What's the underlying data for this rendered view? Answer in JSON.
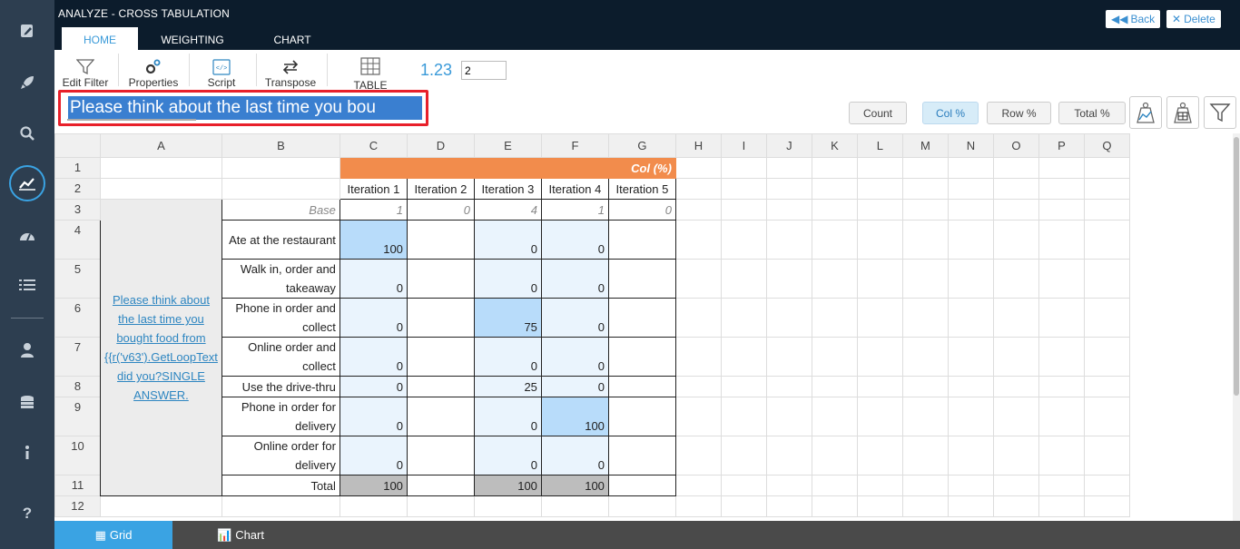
{
  "app": {
    "title": "ANALYZE - CROSS TABULATION"
  },
  "tabs": [
    {
      "label": "HOME"
    },
    {
      "label": "WEIGHTING"
    },
    {
      "label": "CHART"
    }
  ],
  "actions": {
    "back_label": "Back",
    "delete_label": "Delete"
  },
  "toolbar": {
    "edit_filter": "Edit Filter",
    "properties": "Properties",
    "script": "Script",
    "transpose": "Transpose",
    "table": "TABLE",
    "decimals_sample": "1.23",
    "decimals_value": "2"
  },
  "question_title": "Please think about the last time you bou",
  "percent_buttons": {
    "count": "Count",
    "col": "Col %",
    "row": "Row %",
    "total": "Total %"
  },
  "grid": {
    "columns": [
      "A",
      "B",
      "C",
      "D",
      "E",
      "F",
      "G",
      "H",
      "I",
      "J",
      "K",
      "L",
      "M",
      "N",
      "O",
      "P",
      "Q"
    ],
    "col_header": "Col (%)",
    "iterations": [
      "Iteration 1",
      "Iteration 2",
      "Iteration 3",
      "Iteration 4",
      "Iteration 5"
    ],
    "base_label": "Base",
    "base_values": [
      "1",
      "0",
      "4",
      "1",
      "0"
    ],
    "question_text": "Please think about the last time you bought food from {{r('v63').GetLoopText did you?SINGLE ANSWER.",
    "rows": [
      {
        "label": "Ate at the restaurant",
        "values": [
          "100",
          "",
          "0",
          "0",
          ""
        ]
      },
      {
        "label": "Walk in, order and takeaway",
        "values": [
          "0",
          "",
          "0",
          "0",
          ""
        ]
      },
      {
        "label": "Phone in order and collect",
        "values": [
          "0",
          "",
          "75",
          "0",
          ""
        ]
      },
      {
        "label": "Online order and collect",
        "values": [
          "0",
          "",
          "0",
          "0",
          ""
        ]
      },
      {
        "label": "Use the drive-thru",
        "values": [
          "0",
          "",
          "25",
          "0",
          ""
        ]
      },
      {
        "label": "Phone in order for delivery",
        "values": [
          "0",
          "",
          "0",
          "100",
          ""
        ]
      },
      {
        "label": "Online order for delivery",
        "values": [
          "0",
          "",
          "0",
          "0",
          ""
        ]
      }
    ],
    "total_label": "Total",
    "total_values": [
      "100",
      "",
      "100",
      "100",
      ""
    ],
    "row_numbers": [
      "1",
      "2",
      "3",
      "4",
      "5",
      "6",
      "7",
      "8",
      "9",
      "10",
      "11",
      "12"
    ]
  },
  "bottom_tabs": {
    "grid": "Grid",
    "chart": "Chart"
  },
  "colors": {
    "accent": "#3aa3e3",
    "header_orange": "#f28c4c",
    "highlight": "#e8202a"
  }
}
